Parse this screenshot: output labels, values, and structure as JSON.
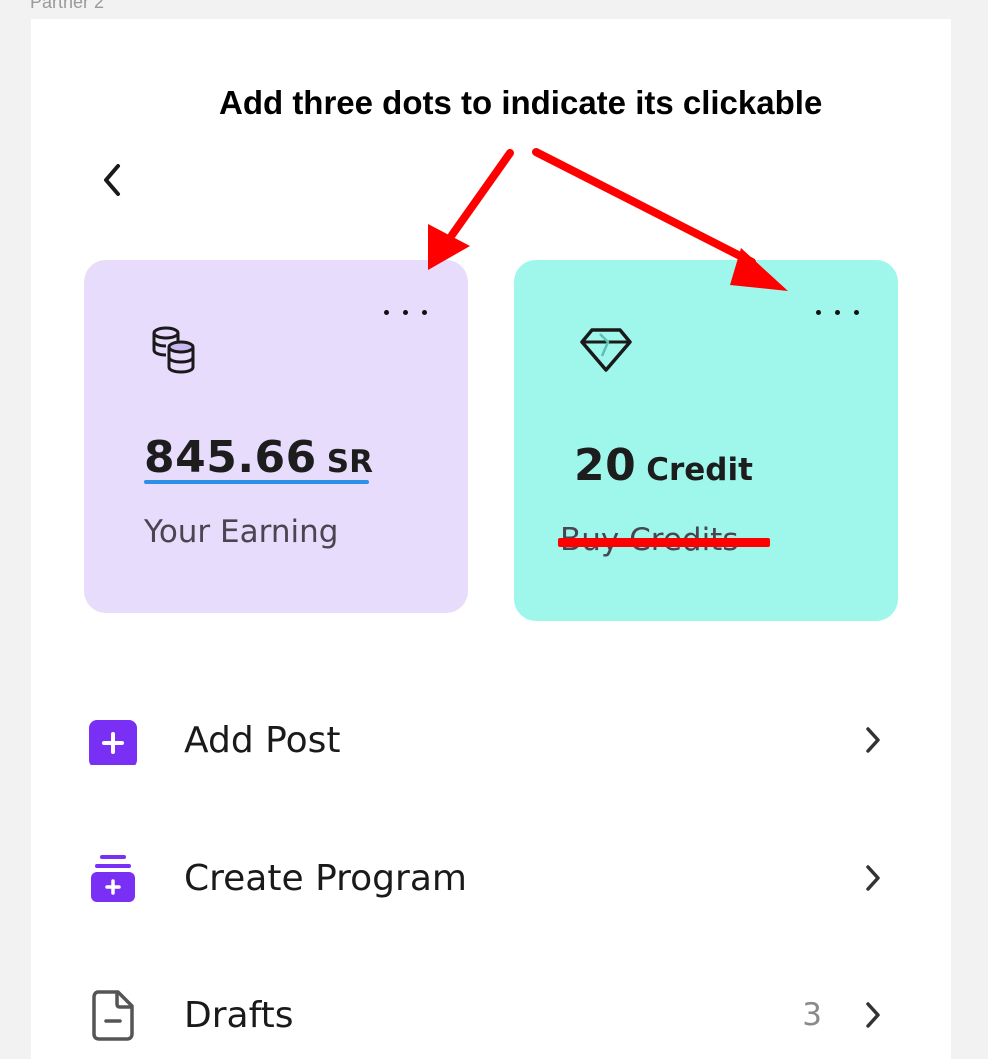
{
  "frame": {
    "label": "Partner 2"
  },
  "annotation": {
    "text": "Add three dots to indicate its clickable",
    "color": "#ff0000"
  },
  "cards": {
    "earning": {
      "amount": "845.66",
      "unit": "SR",
      "label": "Your Earning",
      "icon": "coins-icon",
      "background": "#e8dcfc"
    },
    "credit": {
      "amount": "20",
      "unit": "Credit",
      "label": "Buy Credits",
      "icon": "diamond-icon",
      "background": "#9ff7ec"
    }
  },
  "menu": [
    {
      "label": "Add Post",
      "icon": "add-post-icon",
      "count": ""
    },
    {
      "label": "Create Program",
      "icon": "create-program-icon",
      "count": ""
    },
    {
      "label": "Drafts",
      "icon": "drafts-icon",
      "count": "3"
    }
  ],
  "colors": {
    "accent": "#7a2ff5",
    "chevron": "#333333"
  }
}
